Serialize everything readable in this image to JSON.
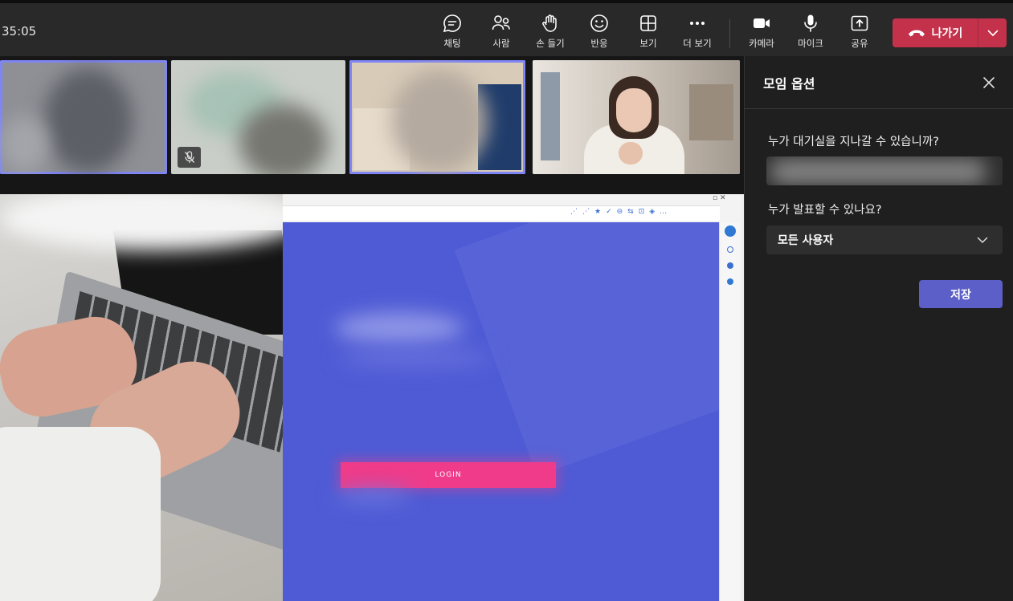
{
  "meeting": {
    "timer": "35:05"
  },
  "toolbar": {
    "chat": "채팅",
    "people": "사람",
    "raise_hand": "손 들기",
    "react": "반응",
    "view": "보기",
    "more": "더 보기",
    "camera": "카메라",
    "mic": "마이크",
    "share": "공유",
    "leave": "나가기"
  },
  "shared_screen": {
    "login_label": "LOGIN"
  },
  "panel": {
    "title": "모임 옵션",
    "lobby_question": "누가 대기실을 지나갈 수 있습니까?",
    "presenter_question": "누가 발표할 수 있나요?",
    "presenter_value": "모든 사용자",
    "save_label": "저장"
  },
  "colors": {
    "accent": "#5b5fc7",
    "leave": "#c4314b",
    "selected_tile": "#7f85f5",
    "login_button": "#ef3b8a",
    "shared_page": "#4f5bd5"
  }
}
